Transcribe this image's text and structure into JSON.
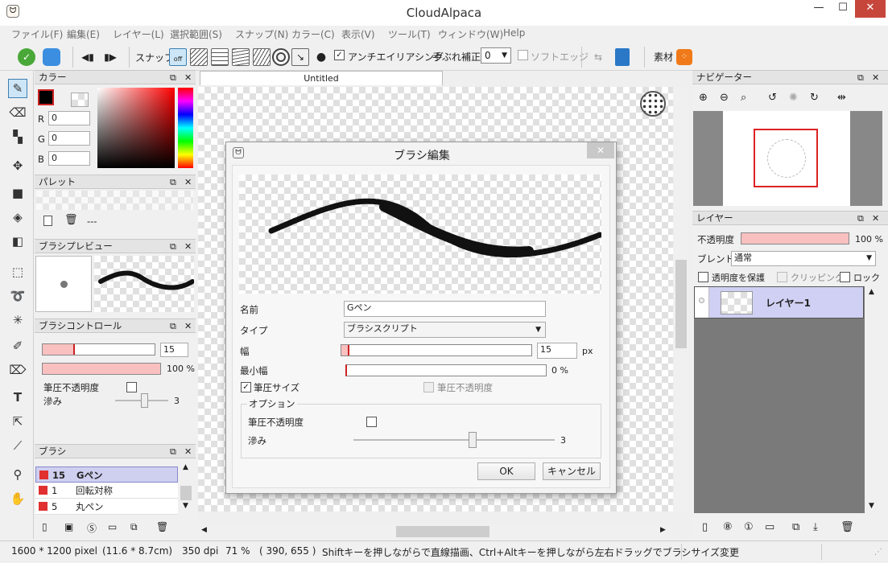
{
  "app": {
    "title": "CloudAlpaca"
  },
  "window_buttons": {
    "minimize": "—",
    "maximize": "☐",
    "close": "✕"
  },
  "menu": [
    "ファイル(F)",
    "編集(E)",
    "レイヤー(L)",
    "選択範囲(S)",
    "スナップ(N)",
    "カラー(C)",
    "表示(V)",
    "ツール(T)",
    "ウィンドウ(W)",
    "Help"
  ],
  "toolbar": {
    "snap_label": "スナップ",
    "snap_off": "off",
    "antialias_label": "アンチエイリアシング",
    "antialias_checked": true,
    "stabilizer_label": "手ぶれ補正",
    "stabilizer_value": "0",
    "soft_edge_label": "ソフトエッジ",
    "material_label": "素材"
  },
  "color_panel": {
    "title": "カラー",
    "r_label": "R",
    "r_value": "0",
    "g_label": "G",
    "g_value": "0",
    "b_label": "B",
    "b_value": "0",
    "current_color": "#000000"
  },
  "palette_panel": {
    "title": "パレット",
    "name": "---"
  },
  "brush_preview_panel": {
    "title": "ブラシプレビュー"
  },
  "brush_control_panel": {
    "title": "ブラシコントロール",
    "width_value": "15",
    "opacity_value": "100 %",
    "pressure_opacity_label": "筆圧不透明度",
    "bleed_label": "滲み",
    "bleed_value": "3"
  },
  "brush_panel": {
    "title": "ブラシ",
    "items": [
      {
        "num": "15",
        "name": "Gペン",
        "selected": true
      },
      {
        "num": "1",
        "name": "回転対称",
        "selected": false
      },
      {
        "num": "5",
        "name": "丸ペン",
        "selected": false
      }
    ]
  },
  "canvas": {
    "tab_label": "Untitled"
  },
  "dialog": {
    "title": "ブラシ編集",
    "close": "✕",
    "name_label": "名前",
    "name_value": "Gペン",
    "type_label": "タイプ",
    "type_value": "ブラシスクリプト",
    "width_label": "幅",
    "width_value": "15",
    "width_unit": "px",
    "min_width_label": "最小幅",
    "min_width_value": "0 %",
    "pressure_size_label": "筆圧サイズ",
    "pressure_size_checked": true,
    "pressure_opacity_label": "筆圧不透明度",
    "options_label": "オプション",
    "opt_pressure_opacity_label": "筆圧不透明度",
    "opt_bleed_label": "滲み",
    "opt_bleed_value": "3",
    "ok_label": "OK",
    "cancel_label": "キャンセル"
  },
  "navigator_panel": {
    "title": "ナビゲーター"
  },
  "layer_panel": {
    "title": "レイヤー",
    "opacity_label": "不透明度",
    "opacity_value": "100 %",
    "blend_label": "ブレンド",
    "blend_value": "通常",
    "protect_alpha_label": "透明度を保護",
    "clipping_label": "クリッピング",
    "lock_label": "ロック",
    "layers": [
      {
        "name": "レイヤー1"
      }
    ]
  },
  "status": {
    "size": "1600 * 1200 pixel",
    "physical": "(11.6 * 8.7cm)",
    "dpi": "350 dpi",
    "zoom": "71 %",
    "coords": "( 390, 655 )",
    "hint": "Shiftキーを押しながらで直線描画、Ctrl+Altキーを押しながら左右ドラッグでブラシサイズ変更"
  }
}
